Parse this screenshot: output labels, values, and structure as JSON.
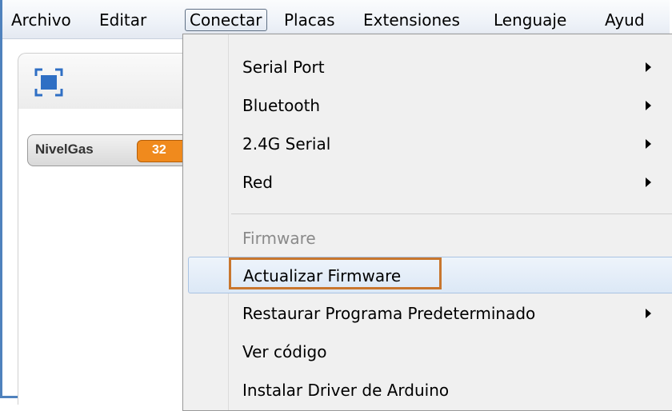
{
  "menubar": {
    "items": [
      {
        "label": "Archivo"
      },
      {
        "label": "Editar"
      },
      {
        "label": "Conectar"
      },
      {
        "label": "Placas"
      },
      {
        "label": "Extensiones"
      },
      {
        "label": "Lenguaje"
      },
      {
        "label": "Ayud"
      }
    ]
  },
  "stage": {
    "fullscreen_icon": "fullscreen-icon"
  },
  "variable_watch": {
    "name": "NivelGas",
    "value": "32"
  },
  "dropdown": {
    "items": [
      {
        "label": "Serial Port",
        "submenu": true
      },
      {
        "label": "Bluetooth",
        "submenu": true
      },
      {
        "label": "2.4G Serial",
        "submenu": true
      },
      {
        "label": "Red",
        "submenu": true
      },
      {
        "label": "Firmware",
        "disabled": true
      },
      {
        "label": "Actualizar Firmware",
        "highlighted": true
      },
      {
        "label": "Restaurar Programa Predeterminado",
        "submenu": true
      },
      {
        "label": "Ver código"
      },
      {
        "label": "Instalar Driver de Arduino"
      }
    ]
  },
  "colors": {
    "frame_border": "#4f82bd",
    "callout": "#c8762e",
    "variable_value_bg": "#f08a1d",
    "fullscreen_icon": "#2f6fc4"
  }
}
